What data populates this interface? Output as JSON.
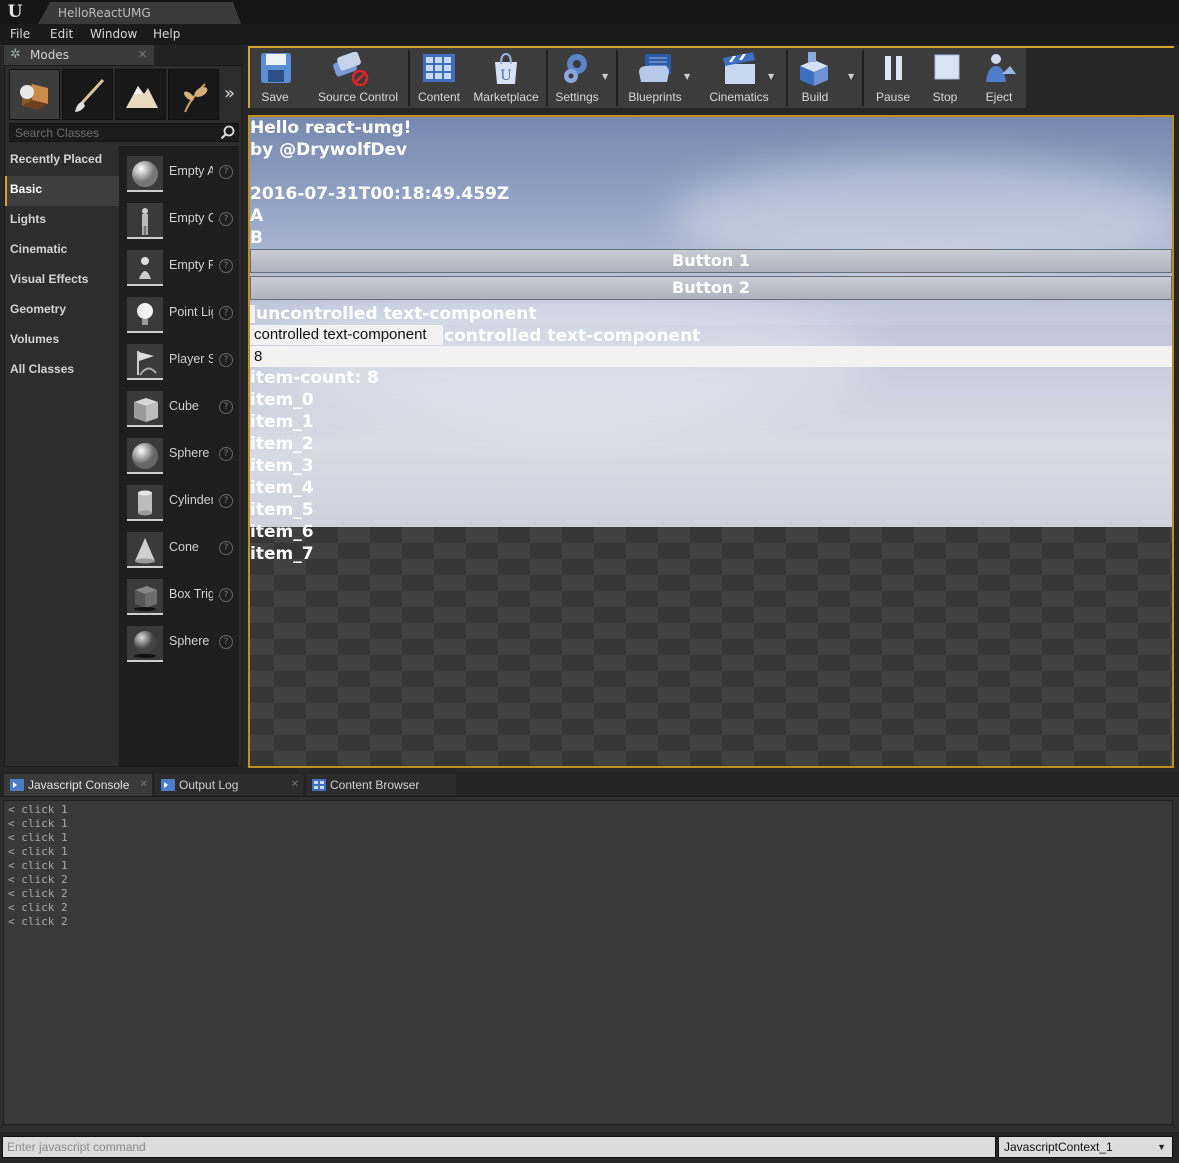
{
  "window": {
    "tab_title": "HelloReactUMG"
  },
  "menu": [
    "File",
    "Edit",
    "Window",
    "Help"
  ],
  "modes": {
    "tab_label": "Modes",
    "search_placeholder": "Search Classes",
    "categories": [
      "Recently Placed",
      "Basic",
      "Lights",
      "Cinematic",
      "Visual Effects",
      "Geometry",
      "Volumes",
      "All Classes"
    ],
    "active_category": "Basic",
    "classes": [
      "Empty Actor",
      "Empty Character",
      "Empty Pawn",
      "Point Light",
      "Player Start",
      "Cube",
      "Sphere",
      "Cylinder",
      "Cone",
      "Box Trigger",
      "Sphere Reflection Capture"
    ],
    "help_glyph": "?"
  },
  "toolbar": {
    "save": "Save",
    "source_control": "Source Control",
    "content": "Content",
    "marketplace": "Marketplace",
    "settings": "Settings",
    "blueprints": "Blueprints",
    "cinematics": "Cinematics",
    "build": "Build",
    "pause": "Pause",
    "stop": "Stop",
    "eject": "Eject"
  },
  "viewport": {
    "line1": "Hello react-umg!",
    "line2": "by @DrywolfDev",
    "timestamp": "2016-07-31T00:18:49.459Z",
    "a": "A",
    "b": "B",
    "button1": "Button 1",
    "button2": "Button 2",
    "uncontrolled": "uncontrolled text-component",
    "controlled_value": "controlled text-component",
    "controlled_label": "controlled text-component",
    "number_value": "8",
    "item_count": "item-count: 8",
    "items": [
      "item_0",
      "item_1",
      "item_2",
      "item_3",
      "item_4",
      "item_5",
      "item_6",
      "item_7"
    ]
  },
  "bottom": {
    "tabs": [
      "Javascript Console",
      "Output Log",
      "Content Browser"
    ],
    "log": [
      "< click 1",
      "< click 1",
      "< click 1",
      "< click 1",
      "< click 1",
      "< click 2",
      "< click 2",
      "< click 2",
      "< click 2"
    ],
    "cmd_placeholder": "Enter javascript command",
    "context": "JavascriptContext_1"
  },
  "colors": {
    "accent": "#d4a52c",
    "viewport_border": "#c08f1f",
    "panel": "#2d2d2d"
  },
  "icons": [
    "unreal-logo-icon",
    "modes-icon",
    "place-mode-icon",
    "paint-mode-icon",
    "landscape-mode-icon",
    "foliage-mode-icon",
    "search-icon",
    "save-icon",
    "source-control-icon",
    "content-icon",
    "marketplace-icon",
    "settings-icon",
    "blueprints-icon",
    "cinematics-icon",
    "build-icon",
    "pause-icon",
    "stop-icon",
    "eject-icon",
    "console-icon",
    "output-log-icon",
    "content-browser-icon"
  ]
}
